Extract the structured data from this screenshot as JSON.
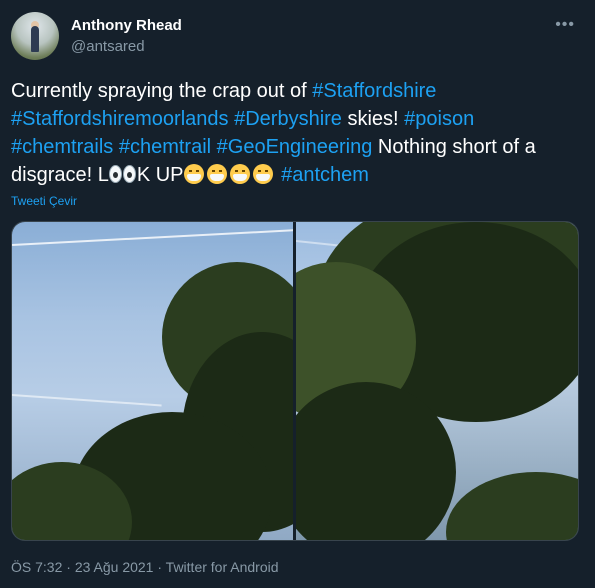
{
  "author": {
    "display_name": "Anthony Rhead",
    "handle": "@antsared"
  },
  "tweet": {
    "text_1": "Currently spraying the crap out of ",
    "tag_staffordshire": "#Staffordshire",
    "tag_staffordshiremoorlands": "#Staffordshiremoorlands",
    "tag_derbyshire": "#Derbyshire",
    "text_2": " skies! ",
    "tag_poison": "#poison",
    "tag_chemtrails": "#chemtrails",
    "tag_chemtrail": "#chemtrail",
    "tag_geoengineering": "#GeoEngineering",
    "text_3": " Nothing short of a disgrace! L",
    "text_4": "K UP",
    "tag_antchem": "#antchem"
  },
  "translate_label": "Tweeti Çevir",
  "meta": {
    "time": "ÖS 7:32",
    "sep1": " · ",
    "date": "23 Ağu 2021",
    "sep2": " · ",
    "source": "Twitter for Android"
  },
  "icons": {
    "more": "more-icon",
    "eyes": "eyes-emoji",
    "mask": "face-with-medical-mask-emoji"
  },
  "colors": {
    "background": "#15202b",
    "hashtag": "#1da1f2",
    "secondary_text": "#8899a6"
  }
}
